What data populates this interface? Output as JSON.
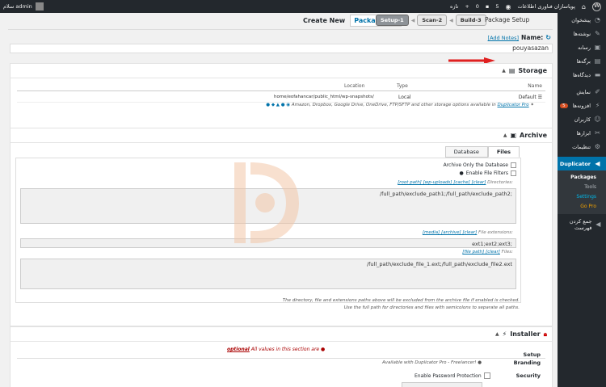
{
  "adminbar": {
    "site_name": "پویاسازان فناوری اطلاعات",
    "comments_count": "0",
    "updates_count": "5",
    "new_label": "تازه",
    "user_label": "سلام admin"
  },
  "sidebar": {
    "items": [
      {
        "label": "پیشخوان",
        "icon": "dashboard-icon"
      },
      {
        "label": "نوشته‌ها",
        "icon": "pin-icon"
      },
      {
        "label": "رسانه",
        "icon": "media-icon"
      },
      {
        "label": "برگه‌ها",
        "icon": "page-icon"
      },
      {
        "label": "دیدگاه‌ها",
        "icon": "comment-icon"
      },
      {
        "label": "نمایش",
        "icon": "brush-icon"
      },
      {
        "label": "افزونه‌ها",
        "icon": "plugin-icon",
        "badge": "5"
      },
      {
        "label": "کاربران",
        "icon": "users-icon"
      },
      {
        "label": "ابزارها",
        "icon": "wrench-icon"
      },
      {
        "label": "تنظیمات",
        "icon": "settings-icon"
      }
    ],
    "active": "Duplicator",
    "submenu": [
      "Packages",
      "Tools",
      "Settings",
      "Go Pro"
    ],
    "collapse": "جمع کردن فهرست"
  },
  "header": {
    "create_new": "Create New",
    "packages": "Packages",
    "steps": [
      "Setup-1",
      "Scan-2",
      "Build-3"
    ],
    "setup_title": "Package Setup"
  },
  "name": {
    "label": "Name:",
    "add_notes": "[Add Notes]",
    "value": "pouyasazan"
  },
  "storage": {
    "title": "Storage",
    "columns": [
      "Name",
      "Type",
      "Location"
    ],
    "row": {
      "name": "Default",
      "type": "Local",
      "location": "home/eofahancar/public_html/wp-snapshots/"
    },
    "note": "Amazon, Dropbox, Google Drive, OneDrive, FTP/SFTP and other storage options available in",
    "note_link": "Duplicator Pro"
  },
  "archive": {
    "title": "Archive",
    "tabs": [
      "Files",
      "Database"
    ],
    "archive_only_db": "Archive Only the Database",
    "enable_filters": "Enable File Filters",
    "directories_label": "Directories:",
    "directories_links": "[root path] [wp-uploads] [cache] [clear]",
    "directories_value": "/full_path/exclude_path1;/full_path/exclude_path2;",
    "ext_label": "File extensions:",
    "ext_links": "[media] [archive] [clear]",
    "ext_value": "ext1;ext2;ext3;",
    "files_label": "Files:",
    "files_links": "[file path] [clear]",
    "files_value": "/full_path/exclude_file_1.ext;/full_path/exclude_file2.ext",
    "hint1": "The directory, file and extensions paths above will be excluded from the archive file if enabled is checked.",
    "hint2": "Use the full path for directories and files with semicolons to separate all paths."
  },
  "installer": {
    "title": "Installer",
    "note_prefix": "All values in this section are",
    "note_optional": "optional",
    "setup_label": "Setup",
    "branding_label": "Branding",
    "branding_value": "Available with Duplicator Pro - Freelancer!",
    "security_label": "Security",
    "password_label": "Enable Password Protection"
  }
}
